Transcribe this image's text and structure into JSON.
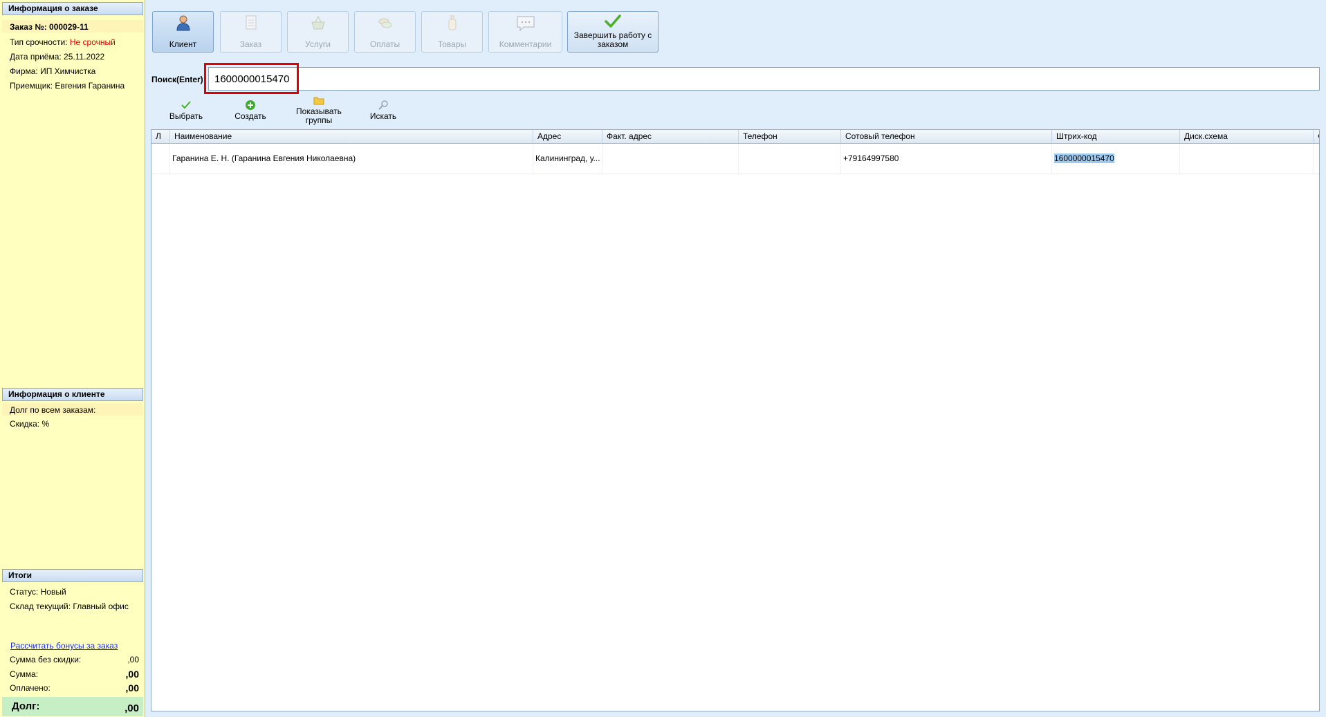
{
  "order_info": {
    "header": "Информация о заказе",
    "order_no": "Заказ №: 000029-11",
    "urgency_label": "Тип срочности:",
    "urgency_value": "Не срочный",
    "date_line": "Дата приёма: 25.11.2022",
    "firm_line": "Фирма: ИП Химчистка",
    "receiver_line": "Приемщик: Евгения Гаранина"
  },
  "client_info": {
    "header": "Информация о клиенте",
    "debt_line": "Долг по всем заказам:",
    "discount_line": "Скидка: %"
  },
  "totals": {
    "header": "Итоги",
    "status_line": "Статус: Новый",
    "warehouse_line": "Склад текущий: Главный офис",
    "bonus_link": "Рассчитать бонусы за заказ",
    "sum_no_discount_label": "Сумма без скидки:",
    "sum_no_discount_value": ",00",
    "sum_label": "Сумма:",
    "sum_value": ",00",
    "paid_label": "Оплачено:",
    "paid_value": ",00",
    "debt_label": "Долг:",
    "debt_value": ",00"
  },
  "toolbar": {
    "client": "Клиент",
    "order": "Заказ",
    "services": "Услуги",
    "payments": "Оплаты",
    "goods": "Товары",
    "comments": "Комментарии",
    "finish": "Завершить работу с заказом"
  },
  "search": {
    "label": "Поиск(Enter)",
    "value": "1600000015470"
  },
  "actions": {
    "select": "Выбрать",
    "create": "Создать",
    "show_groups": "Показывать группы",
    "search": "Искать"
  },
  "grid": {
    "columns": [
      "Л",
      "Наименование",
      "Адрес",
      "Факт. адрес",
      "Телефон",
      "Сотовый телефон",
      "Штрих-код",
      "Диск.схема",
      "Ф"
    ],
    "rows": [
      {
        "l": "",
        "name": "Гаранина Е. Н. (Гаранина Евгения Николаевна)",
        "address": "Калининград, у...",
        "fact_address": "",
        "phone": "",
        "mobile": "+79164997580",
        "barcode": "1600000015470",
        "disc_scheme": ""
      }
    ]
  },
  "colors": {
    "accent_red": "#e00000",
    "panel_yellow": "#ffffc0",
    "link_blue": "#1a2ee8",
    "debt_green": "#c6efc6"
  }
}
